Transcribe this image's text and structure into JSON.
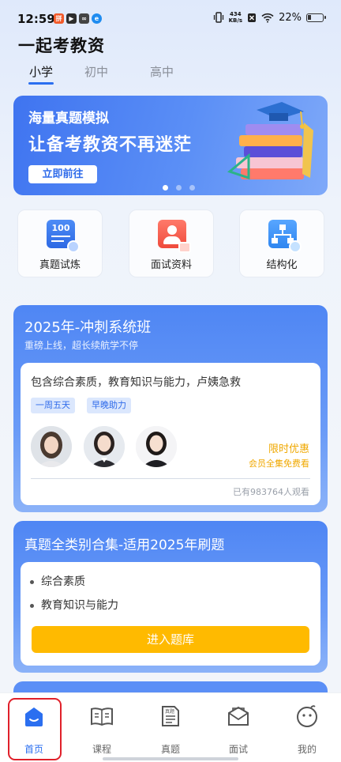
{
  "status_bar": {
    "time": "12:59",
    "net_speed_value": "434",
    "net_speed_unit": "KB/s",
    "battery": "22%"
  },
  "app": {
    "title": "一起考教资"
  },
  "tabs": [
    {
      "label": "小学",
      "active": true
    },
    {
      "label": "初中",
      "active": false
    },
    {
      "label": "高中",
      "active": false
    }
  ],
  "banner": {
    "line1": "海量真题模拟",
    "line2": "让备考教资不再迷茫",
    "button": "立即前往",
    "pages": 3,
    "current_page": 1
  },
  "quick_entries": [
    {
      "label": "真题试炼",
      "icon": "score-100-icon",
      "badge_text": "100"
    },
    {
      "label": "面试资料",
      "icon": "interview-person-icon"
    },
    {
      "label": "结构化",
      "icon": "structure-tree-icon"
    }
  ],
  "course_card": {
    "title": "2025年-冲刺系统班",
    "subtitle": "重磅上线，超长续航学不停",
    "description": "包含综合素质，教育知识与能力，卢姨急救",
    "tags": [
      "一周五天",
      "早晚助力"
    ],
    "promo": "限时优惠",
    "promo_sub": "会员全集免费看",
    "views": "已有983764人观看"
  },
  "bank_card": {
    "title": "真题全类别合集-适用2025年刷题",
    "items": [
      "综合素质",
      "教育知识与能力"
    ],
    "button": "进入题库"
  },
  "bottom_nav": [
    {
      "label": "首页",
      "icon": "home-icon",
      "active": true
    },
    {
      "label": "课程",
      "icon": "book-icon",
      "active": false
    },
    {
      "label": "真题",
      "icon": "exam-paper-icon",
      "active": false
    },
    {
      "label": "面试",
      "icon": "interview-icon",
      "active": false
    },
    {
      "label": "我的",
      "icon": "profile-icon",
      "active": false
    }
  ],
  "colors": {
    "accent": "#2b6ff0",
    "card_blue": "#4f86f4",
    "promo": "#f0a800",
    "button_yellow": "#ffba00",
    "highlight_red": "#e0202a"
  }
}
